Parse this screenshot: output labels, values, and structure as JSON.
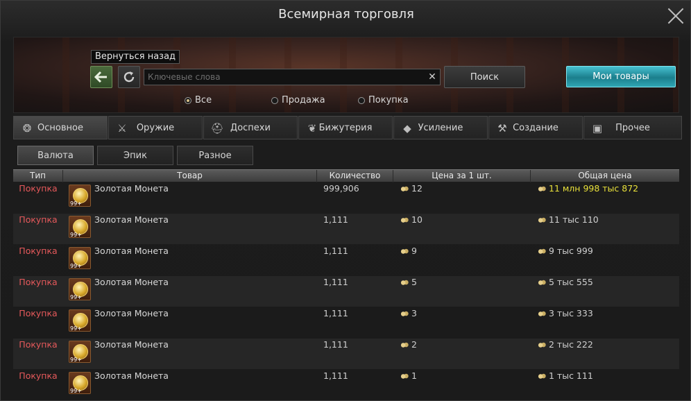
{
  "window": {
    "title": "Всемирная торговля"
  },
  "search": {
    "tooltip": "Вернуться назад",
    "placeholder": "Ключевые слова",
    "clear": "✕",
    "search_label": "Поиск",
    "my_goods_label": "Мои товары"
  },
  "filters": [
    {
      "label": "Все",
      "selected": true
    },
    {
      "label": "Продажа",
      "selected": false
    },
    {
      "label": "Покупка",
      "selected": false
    }
  ],
  "categories": [
    {
      "label": "Основное",
      "icon": "coins-icon",
      "active": true
    },
    {
      "label": "Оружие",
      "icon": "weapon-icon",
      "active": false
    },
    {
      "label": "Доспехи",
      "icon": "helmet-icon",
      "active": false
    },
    {
      "label": "Бижутерия",
      "icon": "jewelry-icon",
      "active": false
    },
    {
      "label": "Усиление",
      "icon": "enhance-icon",
      "active": false
    },
    {
      "label": "Создание",
      "icon": "craft-icon",
      "active": false
    },
    {
      "label": "Прочее",
      "icon": "box-icon",
      "active": false
    }
  ],
  "subtabs": [
    {
      "label": "Валюта",
      "active": true
    },
    {
      "label": "Эпик",
      "active": false
    },
    {
      "label": "Разное",
      "active": false
    }
  ],
  "table": {
    "headers": [
      "Тип",
      "Товар",
      "Количество",
      "Цена за 1 шт.",
      "Общая цена"
    ],
    "rows": [
      {
        "type": "Покупка",
        "name": "Золотая Монета",
        "icon_qty": "99+",
        "qty": "999,906",
        "price": "12",
        "total": "11 млн 998 тыс 872"
      },
      {
        "type": "Покупка",
        "name": "Золотая Монета",
        "icon_qty": "99+",
        "qty": "1,111",
        "price": "10",
        "total": "11 тыс 110"
      },
      {
        "type": "Покупка",
        "name": "Золотая Монета",
        "icon_qty": "99+",
        "qty": "1,111",
        "price": "9",
        "total": "9 тыс 999"
      },
      {
        "type": "Покупка",
        "name": "Золотая Монета",
        "icon_qty": "99+",
        "qty": "1,111",
        "price": "5",
        "total": "5 тыс 555"
      },
      {
        "type": "Покупка",
        "name": "Золотая Монета",
        "icon_qty": "99+",
        "qty": "1,111",
        "price": "3",
        "total": "3 тыс 333"
      },
      {
        "type": "Покупка",
        "name": "Золотая Монета",
        "icon_qty": "99+",
        "qty": "1,111",
        "price": "2",
        "total": "2 тыс 222"
      },
      {
        "type": "Покупка",
        "name": "Золотая Монета",
        "icon_qty": "99+",
        "qty": "1,111",
        "price": "1",
        "total": "1 тыс 111"
      }
    ]
  },
  "colors": {
    "buy": "#e6595b",
    "highlight_total": "#e8e03a",
    "accent": "#46c0d0"
  }
}
